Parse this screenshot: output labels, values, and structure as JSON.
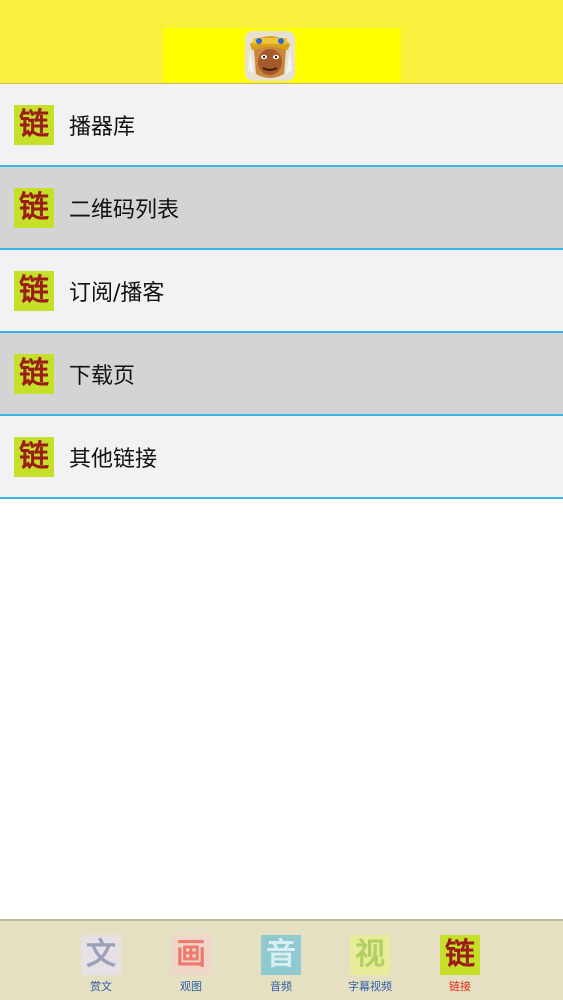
{
  "header": {
    "avatar_icon": "monkey-king-avatar-icon",
    "brand_color": "#f7f03c"
  },
  "list": {
    "items": [
      {
        "icon_char": "链",
        "label": "播器库"
      },
      {
        "icon_char": "链",
        "label": "二维码列表"
      },
      {
        "icon_char": "链",
        "label": "订阅/播客"
      },
      {
        "icon_char": "链",
        "label": "下载页"
      },
      {
        "icon_char": "链",
        "label": "其他链接"
      }
    ],
    "divider_color": "#35b6e6"
  },
  "tabbar": {
    "tabs": [
      {
        "icon_char": "文",
        "label": "赏文",
        "active": false
      },
      {
        "icon_char": "画",
        "label": "观图",
        "active": false
      },
      {
        "icon_char": "音",
        "label": "音频",
        "active": false
      },
      {
        "icon_char": "视",
        "label": "字幕视频",
        "active": false
      },
      {
        "icon_char": "链",
        "label": "链接",
        "active": true
      }
    ],
    "active_color": "#e0281a",
    "inactive_color": "#2f5ea8"
  }
}
